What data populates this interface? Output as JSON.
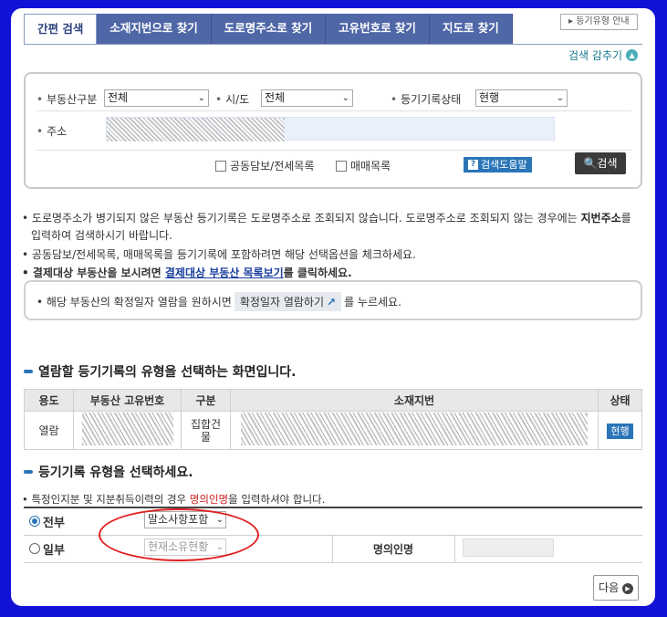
{
  "tabs": [
    "간편 검색",
    "소재지번으로 찾기",
    "도로명주소로 찾기",
    "고유번호로 찾기",
    "지도로 찾기"
  ],
  "guide_button": "▸ 등기유형 안내",
  "collapse_label": "검색 감추기",
  "search": {
    "property_type_label": "부동산구분",
    "property_type_value": "전체",
    "city_label": "시/도",
    "city_value": "전체",
    "record_status_label": "등기기록상태",
    "record_status_value": "현행",
    "address_label": "주소",
    "jeonse_label": "공동담보/전세목록",
    "sale_label": "매매목록",
    "help_label": "검색도움말",
    "search_button": "검색"
  },
  "notices": {
    "n1a": "도로명주소가 병기되지 않은 부동산 등기기록은 도로명주소로 조회되지 않습니다. 도로명주소로 조회되지 않는 경우에는 ",
    "n1b": "지번주소",
    "n1c": "를",
    "n1d": "입력하여 검색하시기 바랍니다.",
    "n2": "공동담보/전세목록, 매매목록을 등기기록에 포함하려면 해당 선택옵션을 체크하세요.",
    "n3a": "결제대상 부동산을 보시려면 ",
    "n3link": "결제대상 부동산 목록보기",
    "n3b": "를 클릭하세요.",
    "confirm_a": "해당 부동산의 확정일자 열람을 원하시면",
    "confirm_btn": "확정일자 열람하기",
    "confirm_b": "를 누르세요."
  },
  "section1_title": "열람할 등기기록의 유형을 선택하는 화면입니다.",
  "table": {
    "headers": [
      "용도",
      "부동산 고유번호",
      "구분",
      "소재지번",
      "상태"
    ],
    "row": {
      "use": "열람",
      "category": "집합건물",
      "status": "현행"
    }
  },
  "section2_title": "등기기록 유형을 선택하세요.",
  "section2_note_a": "특정인지분 및 지분취득이력의 경우 ",
  "section2_note_red": "명의인명",
  "section2_note_b": "을 입력하셔야 합니다.",
  "type_rows": {
    "all_label": "전부",
    "all_select": "말소사항포함",
    "part_label": "일부",
    "part_select": "현재소유현황",
    "name_label": "명의인명"
  },
  "next_button": "다음",
  "colors": {
    "accent": "#2a75b8",
    "tab_bg": "#4f67a7",
    "frame": "#1212d6",
    "annotation": "#e02020"
  }
}
